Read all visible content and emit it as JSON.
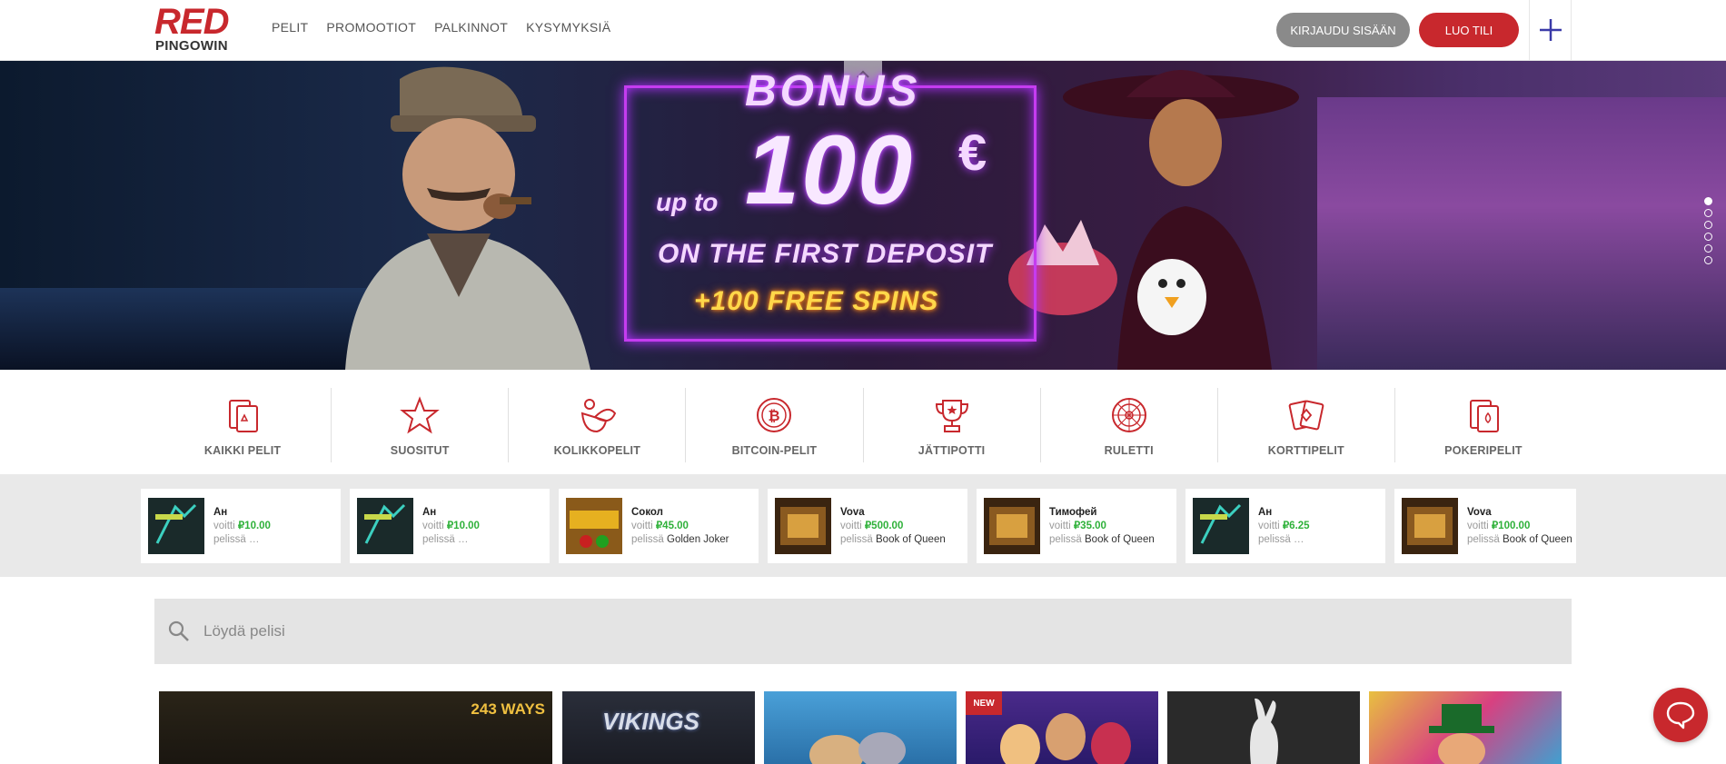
{
  "brand": {
    "logo_top": "RED",
    "logo_bottom": "PINGOWIN"
  },
  "nav": {
    "items": [
      "PELIT",
      "PROMOOTIOT",
      "PALKINNOT",
      "KYSYMYKSIÄ"
    ]
  },
  "header": {
    "login_label": "KIRJAUDU SISÄÄN",
    "create_label": "LUO TILI"
  },
  "hero": {
    "bonus": "BONUS",
    "up_to": "up to",
    "amount": "100",
    "currency": "€",
    "deposit": "ON THE FIRST DEPOSIT",
    "spins": "+100 FREE SPINS",
    "active_slide": 1,
    "slide_count": 6
  },
  "categories": [
    {
      "label": "KAIKKI PELIT",
      "icon": "cards-icon"
    },
    {
      "label": "SUOSITUT",
      "icon": "star-icon"
    },
    {
      "label": "KOLIKKOPELIT",
      "icon": "fruit-icon"
    },
    {
      "label": "BITCOIN-PELIT",
      "icon": "bitcoin-icon"
    },
    {
      "label": "JÄTTIPOTTI",
      "icon": "trophy-icon"
    },
    {
      "label": "RULETTI",
      "icon": "roulette-icon"
    },
    {
      "label": "KORTTIPELIT",
      "icon": "playing-cards-icon"
    },
    {
      "label": "POKERIPELIT",
      "icon": "poker-icon"
    }
  ],
  "winners": [
    {
      "name": "Ан",
      "won": "voitti",
      "amount": "₽10.00",
      "in": "pelissä",
      "game": "…"
    },
    {
      "name": "Ан",
      "won": "voitti",
      "amount": "₽10.00",
      "in": "pelissä",
      "game": "…"
    },
    {
      "name": "Сокол",
      "won": "voitti",
      "amount": "₽45.00",
      "in": "pelissä",
      "game": "Golden Joker"
    },
    {
      "name": "Vova",
      "won": "voitti",
      "amount": "₽500.00",
      "in": "pelissä",
      "game": "Book of Queen"
    },
    {
      "name": "Тимофей",
      "won": "voitti",
      "amount": "₽35.00",
      "in": "pelissä",
      "game": "Book of Queen"
    },
    {
      "name": "Ан",
      "won": "voitti",
      "amount": "₽6.25",
      "in": "pelissä",
      "game": "…"
    },
    {
      "name": "Vova",
      "won": "voitti",
      "amount": "₽100.00",
      "in": "pelissä",
      "game": "Book of Queen"
    }
  ],
  "search": {
    "placeholder": "Löydä pelisi"
  },
  "tiles": {
    "ways_label": "243 WAYS",
    "vikings_label": "VIKINGS",
    "new_badge": "NEW"
  },
  "colors": {
    "brand_red": "#c8282d",
    "login_gray": "#8a8a8a",
    "winner_green": "#2fb13a",
    "plus_blue": "#3a3aa8"
  }
}
